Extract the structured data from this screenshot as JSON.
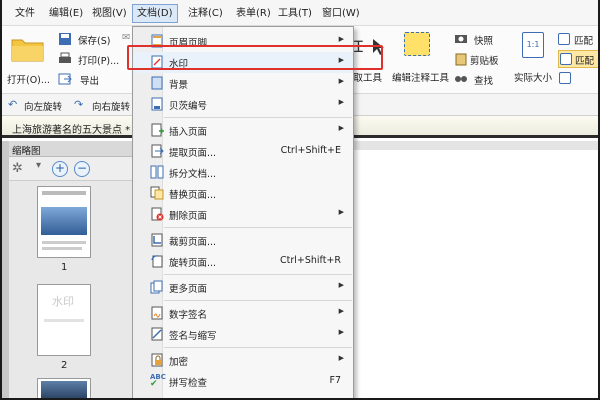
{
  "menubar": {
    "items": [
      "文件",
      "编辑(E)",
      "视图(V)",
      "文档(D)",
      "注释(C)",
      "表单(R)",
      "工具(T)",
      "窗口(W)"
    ],
    "active_index": 3
  },
  "ribbon": {
    "open_label": "打开(O)...",
    "save_label": "保存(S)",
    "print_label": "打印(P)...",
    "export_label": "导出",
    "snapshot_label": "快照",
    "clipboard_label": "剪贴板",
    "find_label": "查找",
    "actual_size_label": "实际大小",
    "match1_label": "匹配",
    "match2_label": "匹配",
    "extract_tool_label": "选取工具",
    "edit_annot_tool_label": "编辑注释工具",
    "actual_size_icon_text": "1:1"
  },
  "rotbar": {
    "rotate_left_label": "向左旋转",
    "rotate_right_label": "向右旋转"
  },
  "document": {
    "title": "上海旅游著名的五大景点 *"
  },
  "thumbnails": {
    "header": "缩略图",
    "pages": [
      "1",
      "2"
    ],
    "page2_watermark_text": "水印"
  },
  "dropdown": {
    "items": [
      {
        "label": "页眉页脚",
        "shortcut": "",
        "submenu": true,
        "icon": "header-footer-icon"
      },
      {
        "label": "水印",
        "shortcut": "",
        "submenu": true,
        "icon": "watermark-icon"
      },
      {
        "label": "背景",
        "shortcut": "",
        "submenu": true,
        "icon": "background-icon"
      },
      {
        "label": "贝茨编号",
        "shortcut": "",
        "submenu": true,
        "icon": "bates-icon"
      },
      {
        "label": "插入页面",
        "shortcut": "",
        "submenu": true,
        "icon": "insert-page-icon"
      },
      {
        "label": "提取页面...",
        "shortcut": "Ctrl+Shift+E",
        "submenu": false,
        "icon": "extract-page-icon"
      },
      {
        "label": "拆分文档...",
        "shortcut": "",
        "submenu": false,
        "icon": "split-doc-icon"
      },
      {
        "label": "替换页面...",
        "shortcut": "",
        "submenu": false,
        "icon": "replace-page-icon"
      },
      {
        "label": "删除页面",
        "shortcut": "",
        "submenu": true,
        "icon": "delete-page-icon"
      },
      {
        "label": "裁剪页面...",
        "shortcut": "",
        "submenu": false,
        "icon": "crop-page-icon"
      },
      {
        "label": "旋转页面...",
        "shortcut": "Ctrl+Shift+R",
        "submenu": false,
        "icon": "rotate-page-icon"
      },
      {
        "label": "更多页面",
        "shortcut": "",
        "submenu": true,
        "icon": "more-pages-icon"
      },
      {
        "label": "数字签名",
        "shortcut": "",
        "submenu": true,
        "icon": "digital-signature-icon"
      },
      {
        "label": "签名与缩写",
        "shortcut": "",
        "submenu": true,
        "icon": "sign-initials-icon"
      },
      {
        "label": "加密",
        "shortcut": "",
        "submenu": true,
        "icon": "encrypt-icon"
      },
      {
        "label": "拼写检查",
        "shortcut": "F7",
        "submenu": false,
        "icon": "spell-check-icon"
      }
    ],
    "spell_icon_text": "ABC",
    "highlighted_index": 1
  },
  "colors": {
    "highlight_border": "#e0302b",
    "active_menu_bg": "#dbe8f7"
  }
}
